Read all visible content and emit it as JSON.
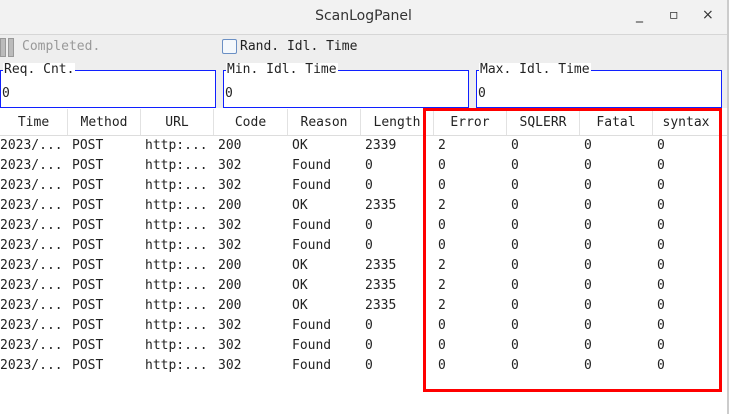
{
  "window": {
    "title": "ScanLogPanel",
    "minimize": "_",
    "maximize": "▫",
    "close": "×"
  },
  "toolbar": {
    "status": "Completed.",
    "random_idle_label": "Rand. Idl. Time",
    "random_idle_checked": false
  },
  "fields": [
    {
      "label": "Req. Cnt.",
      "value": "0"
    },
    {
      "label": "Min. Idl. Time",
      "value": "0"
    },
    {
      "label": "Max. Idl. Time",
      "value": "0"
    }
  ],
  "table": {
    "columns": [
      "Time",
      "Method",
      "URL",
      "Code",
      "Reason",
      "Length",
      "Error",
      "SQLERR",
      "Fatal",
      "syntax"
    ],
    "rows": [
      [
        "2023/...",
        "POST",
        "http:...",
        "200",
        "OK",
        "2339",
        "2",
        "0",
        "0",
        "0"
      ],
      [
        "2023/...",
        "POST",
        "http:...",
        "302",
        "Found",
        "0",
        "0",
        "0",
        "0",
        "0"
      ],
      [
        "2023/...",
        "POST",
        "http:...",
        "302",
        "Found",
        "0",
        "0",
        "0",
        "0",
        "0"
      ],
      [
        "2023/...",
        "POST",
        "http:...",
        "200",
        "OK",
        "2335",
        "2",
        "0",
        "0",
        "0"
      ],
      [
        "2023/...",
        "POST",
        "http:...",
        "302",
        "Found",
        "0",
        "0",
        "0",
        "0",
        "0"
      ],
      [
        "2023/...",
        "POST",
        "http:...",
        "302",
        "Found",
        "0",
        "0",
        "0",
        "0",
        "0"
      ],
      [
        "2023/...",
        "POST",
        "http:...",
        "200",
        "OK",
        "2335",
        "2",
        "0",
        "0",
        "0"
      ],
      [
        "2023/...",
        "POST",
        "http:...",
        "200",
        "OK",
        "2335",
        "2",
        "0",
        "0",
        "0"
      ],
      [
        "2023/...",
        "POST",
        "http:...",
        "200",
        "OK",
        "2335",
        "2",
        "0",
        "0",
        "0"
      ],
      [
        "2023/...",
        "POST",
        "http:...",
        "302",
        "Found",
        "0",
        "0",
        "0",
        "0",
        "0"
      ],
      [
        "2023/...",
        "POST",
        "http:...",
        "302",
        "Found",
        "0",
        "0",
        "0",
        "0",
        "0"
      ],
      [
        "2023/...",
        "POST",
        "http:...",
        "302",
        "Found",
        "0",
        "0",
        "0",
        "0",
        "0"
      ]
    ]
  },
  "highlight_color": "#ff0000"
}
